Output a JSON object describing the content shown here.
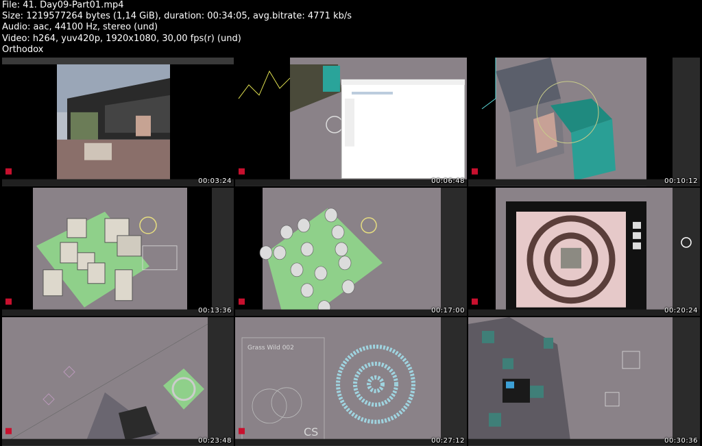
{
  "header": {
    "file": "File: 41. Day09-Part01.mp4",
    "size": "Size: 1219577264 bytes (1,14 GiB), duration: 00:34:05, avg.bitrate: 4771 kb/s",
    "audio": "Audio: aac, 44100 Hz, stereo (und)",
    "video": "Video: h264, yuv420p, 1920x1080, 30,00 fps(r) (und)",
    "encoder": "Orthodox"
  },
  "thumbnails": [
    {
      "timestamp": "00:03:24"
    },
    {
      "timestamp": "00:06:48"
    },
    {
      "timestamp": "00:10:12"
    },
    {
      "timestamp": "00:13:36"
    },
    {
      "timestamp": "00:17:00"
    },
    {
      "timestamp": "00:20:24"
    },
    {
      "timestamp": "00:23:48"
    },
    {
      "timestamp": "00:27:12"
    },
    {
      "timestamp": "00:30:36"
    }
  ],
  "scene_labels": {
    "grass": "Grass Wild 002",
    "cs": "CS"
  },
  "colors": {
    "viewport_grey": "#8a8288",
    "panel_dark": "#2b2b2b",
    "grass_green": "#8fd08a",
    "selection_cyan": "#5fe0e0",
    "brand_red": "#c8102e"
  }
}
